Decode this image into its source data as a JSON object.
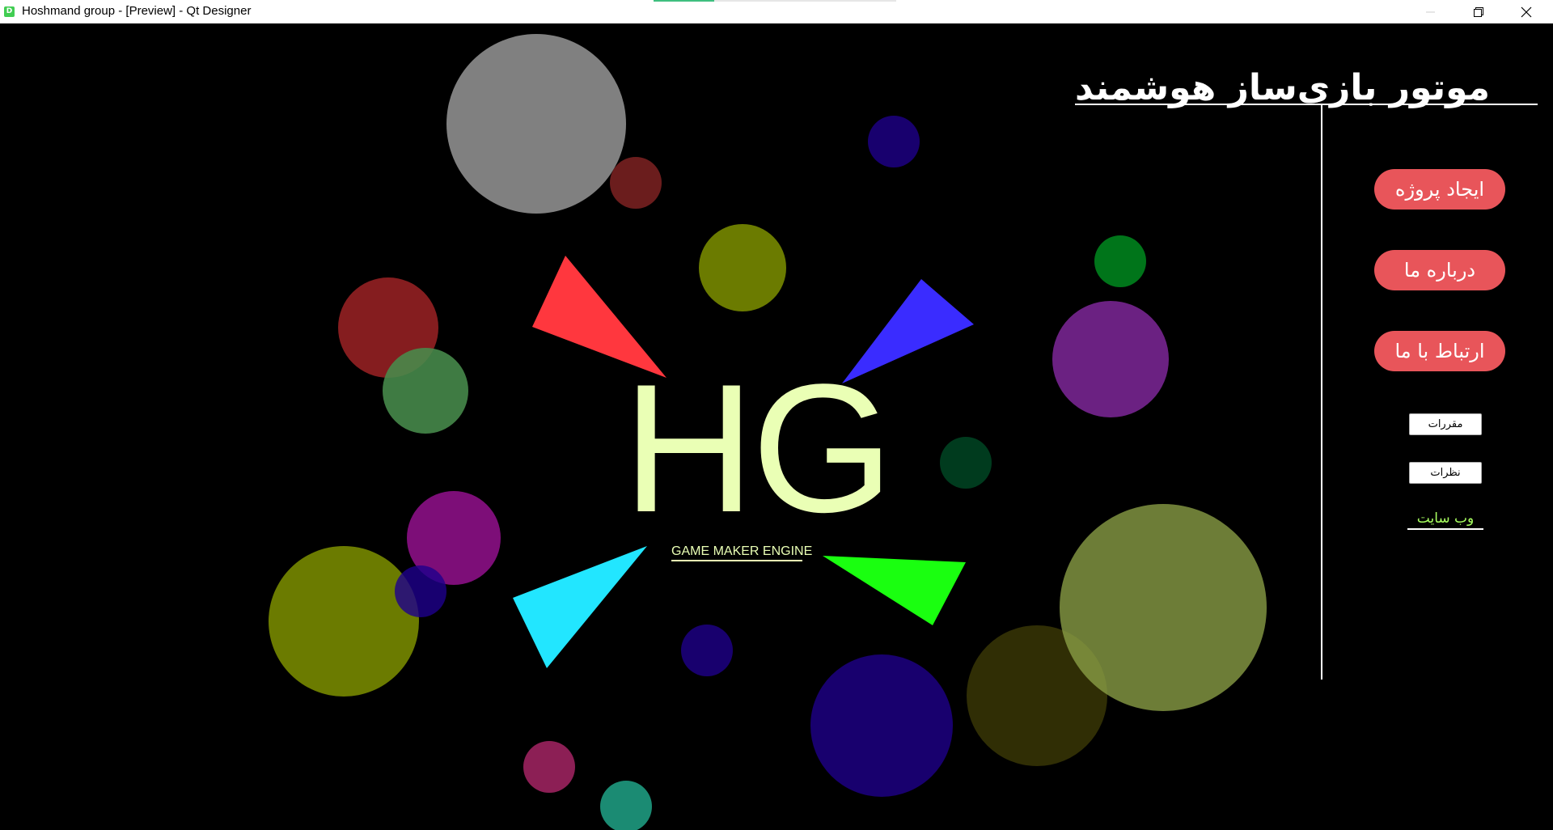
{
  "window": {
    "title": "Hoshmand group - [Preview] - Qt Designer",
    "app_icon_letter": "D",
    "progress": 0.25,
    "controls": [
      "minimize-icon",
      "restore-icon",
      "close-icon"
    ]
  },
  "logo": {
    "text": "HG",
    "subtitle": "GAME MAKER ENGINE",
    "color": "#eaffb5"
  },
  "header": {
    "title": "موتور بازی‌ساز هوشمند"
  },
  "menu": {
    "create_project": "ایجاد پروژه",
    "about_us": "درباره ما",
    "contact_us": "ارتباط با ما",
    "rules": "مقررات",
    "comments": "نظرات",
    "website": "وب سایت"
  },
  "colors": {
    "accent_button": "#e8555a",
    "link": "#a8ff60",
    "background": "#000000"
  }
}
